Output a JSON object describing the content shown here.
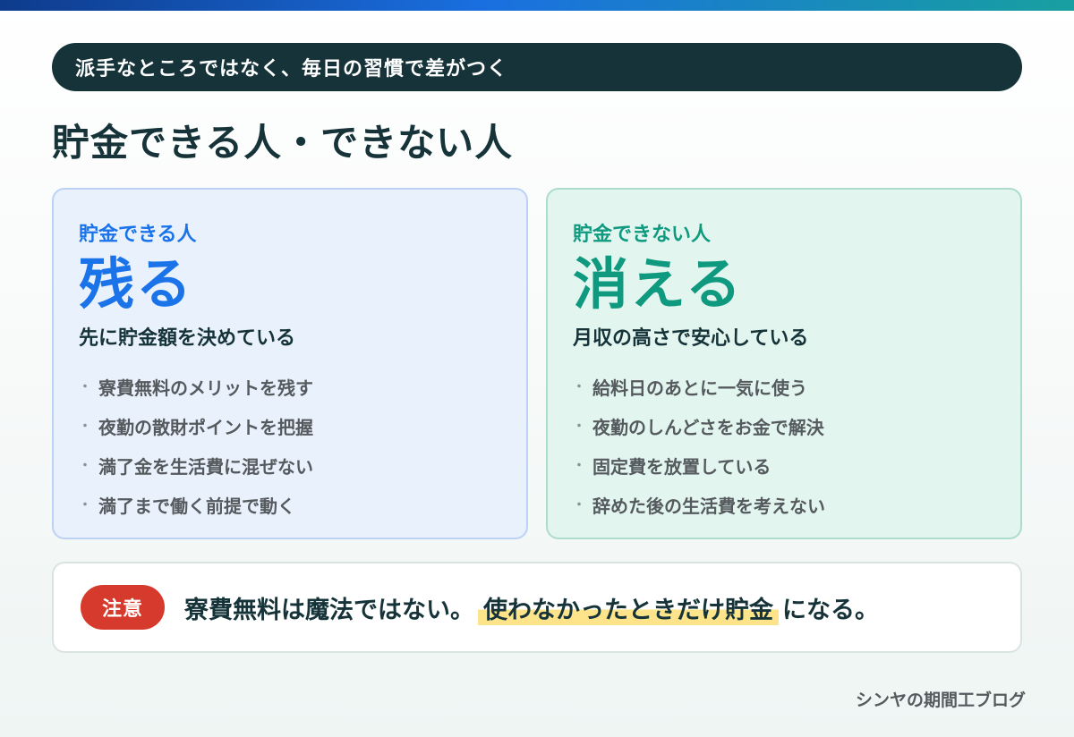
{
  "tagline": "派手なところではなく、毎日の習慣で差がつく",
  "title": "貯金できる人・できない人",
  "cards": {
    "left": {
      "sub": "貯金できる人",
      "big": "残る",
      "lead": "先に貯金額を決めている",
      "items": [
        "寮費無料のメリットを残す",
        "夜勤の散財ポイントを把握",
        "満了金を生活費に混ぜない",
        "満了まで働く前提で動く"
      ]
    },
    "right": {
      "sub": "貯金できない人",
      "big": "消える",
      "lead": "月収の高さで安心している",
      "items": [
        "給料日のあとに一気に使う",
        "夜勤のしんどさをお金で解決",
        "固定費を放置している",
        "辞めた後の生活費を考えない"
      ]
    }
  },
  "bullet_mark": "・",
  "note": {
    "badge": "注意",
    "text_before": "寮費無料は魔法ではない。",
    "text_highlight": "使わなかったときだけ貯金",
    "text_after": "になる。"
  },
  "footer": "シンヤの期間工ブログ",
  "colors": {
    "accent_blue": "#1a73e8",
    "accent_green": "#0f9a80",
    "dark": "#153338",
    "warning_red": "#d63a2c",
    "highlight_yellow": "#fde38a"
  }
}
